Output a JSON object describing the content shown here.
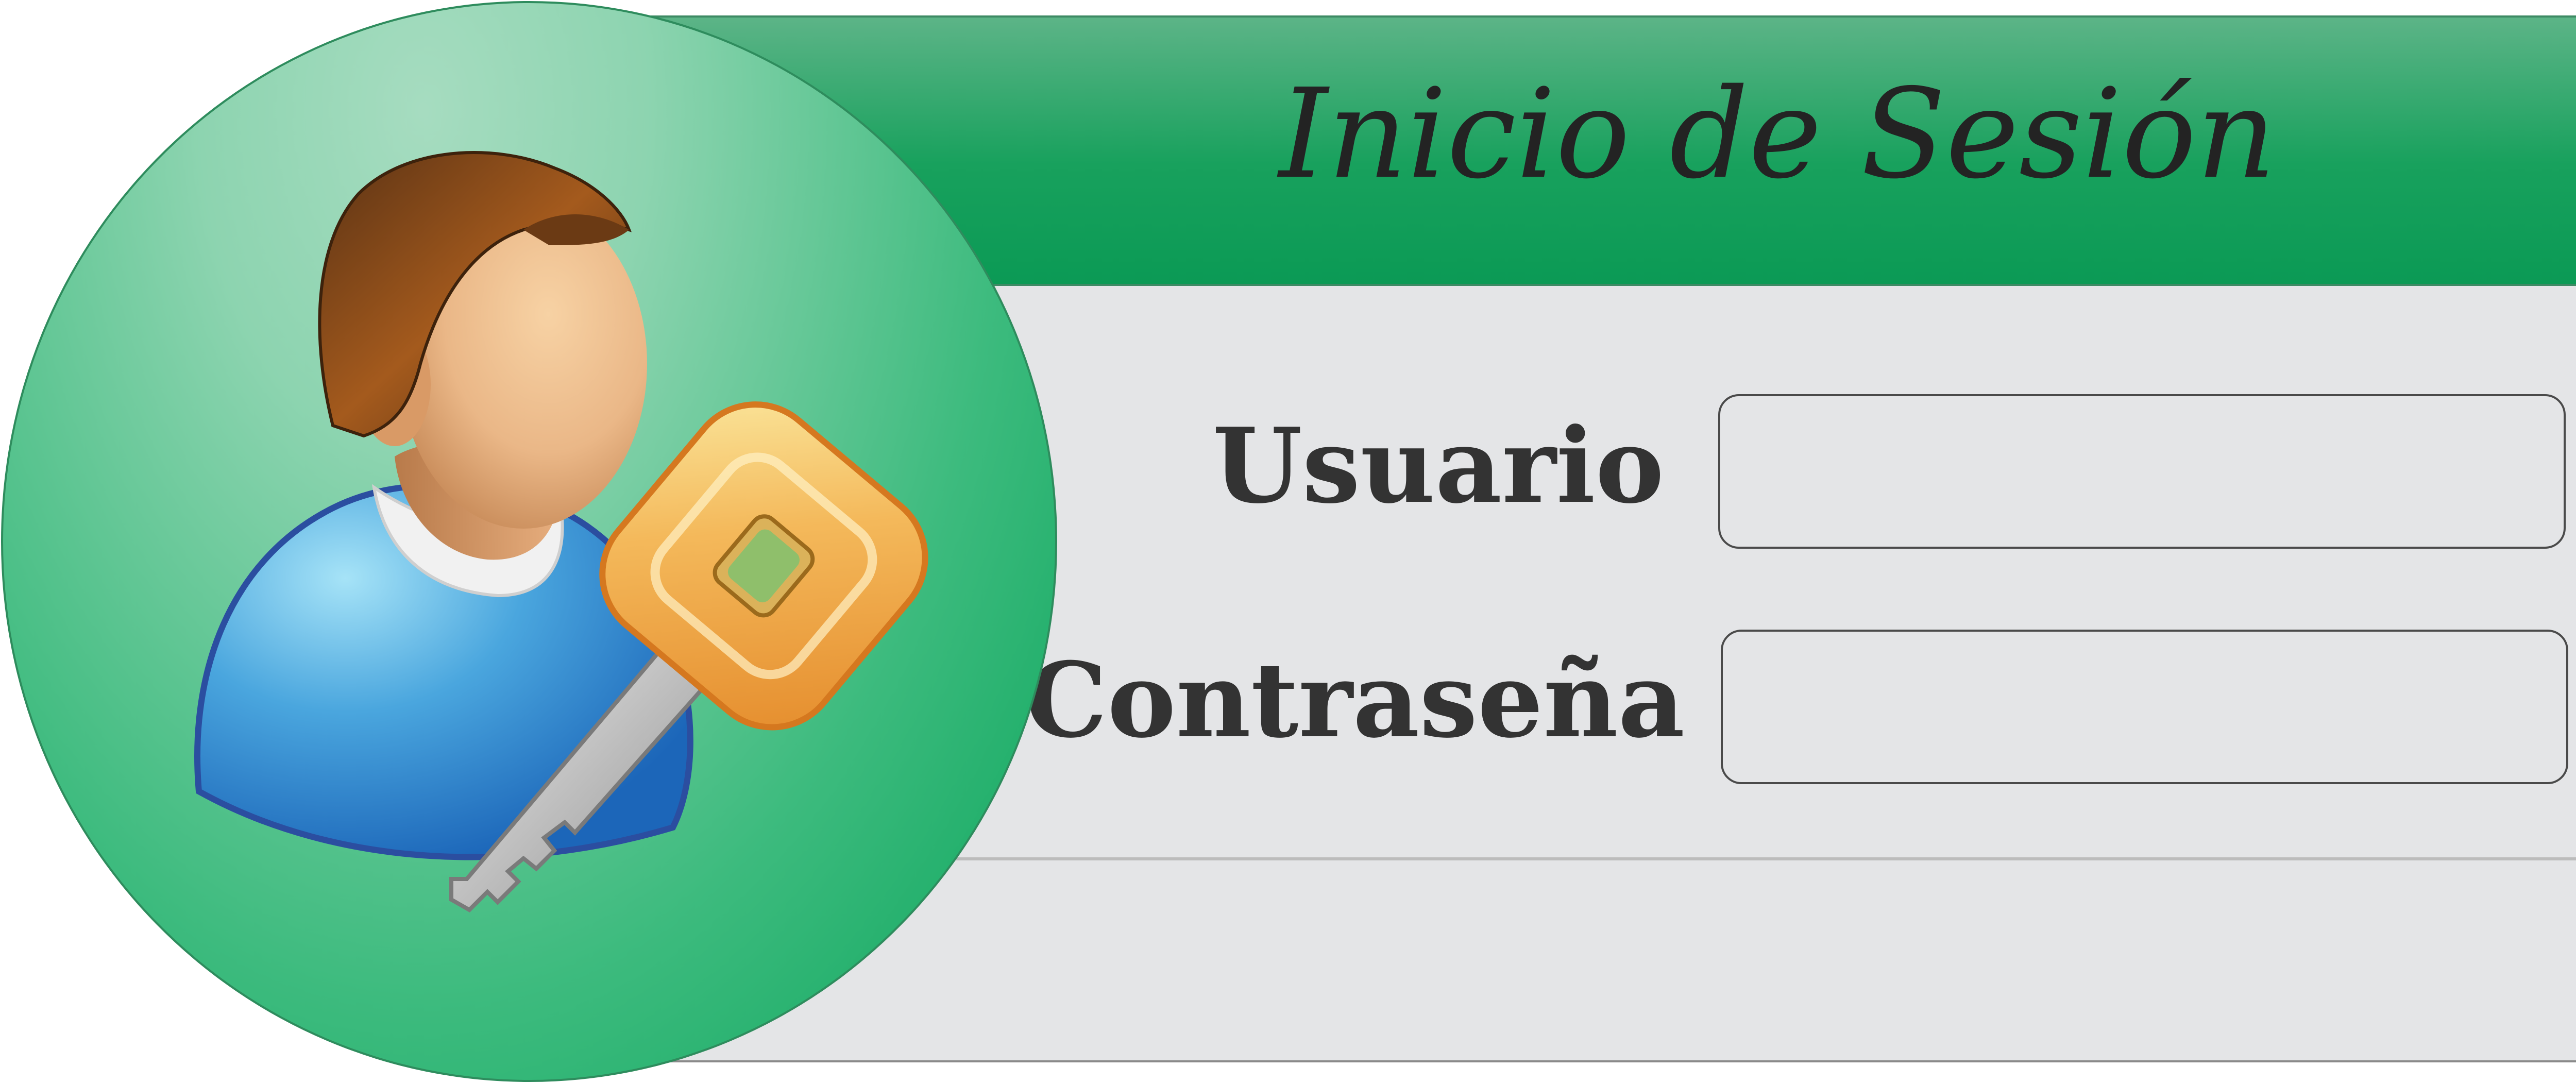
{
  "login_dialog": {
    "title": "Inicio de Sesión",
    "fields": {
      "username": {
        "label": "Usuario",
        "value": "",
        "placeholder": ""
      },
      "password": {
        "label": "Contraseña",
        "value": "",
        "placeholder": ""
      }
    },
    "icons": {
      "avatar": "user-with-key-icon"
    },
    "colors": {
      "header_green": "#0b9a55",
      "circle_green": "#3dbb7e",
      "panel_gray": "#e4e5e7",
      "text_dark": "#333333"
    }
  }
}
